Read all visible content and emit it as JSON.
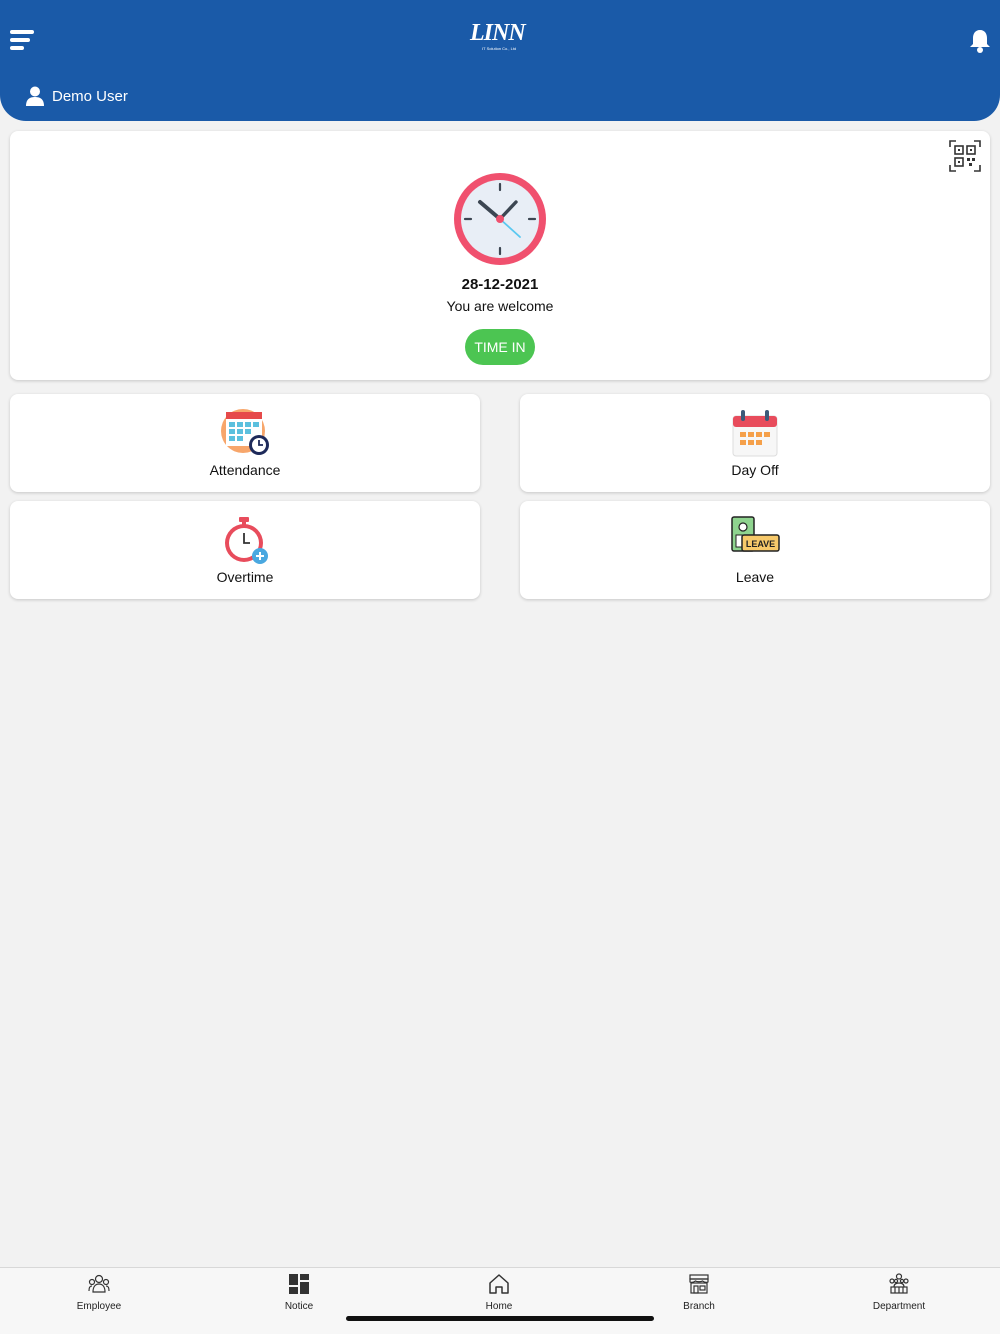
{
  "header": {
    "logo_text": "LINN",
    "logo_subtext": "IT Solution Co., Ltd",
    "user_name": "Demo User",
    "menu_icon": "menu-icon",
    "bell_icon": "bell-icon"
  },
  "clock_card": {
    "date": "28-12-2021",
    "welcome": "You are welcome",
    "time_in_label": "TIME IN",
    "qr_icon": "qr-code-icon"
  },
  "tiles": [
    {
      "label": "Attendance",
      "icon": "attendance-calendar-icon"
    },
    {
      "label": "Day Off",
      "icon": "calendar-icon"
    },
    {
      "label": "Overtime",
      "icon": "stopwatch-icon"
    },
    {
      "label": "Leave",
      "icon": "leave-badge-icon"
    }
  ],
  "bottom_nav": [
    {
      "label": "Employee",
      "icon": "employee-icon"
    },
    {
      "label": "Notice",
      "icon": "notice-grid-icon"
    },
    {
      "label": "Home",
      "icon": "home-icon"
    },
    {
      "label": "Branch",
      "icon": "branch-store-icon"
    },
    {
      "label": "Department",
      "icon": "department-icon"
    }
  ],
  "colors": {
    "header": "#1a5aa8",
    "time_in": "#4cc552",
    "background": "#f2f2f2",
    "clock_rim": "#f0506e"
  }
}
